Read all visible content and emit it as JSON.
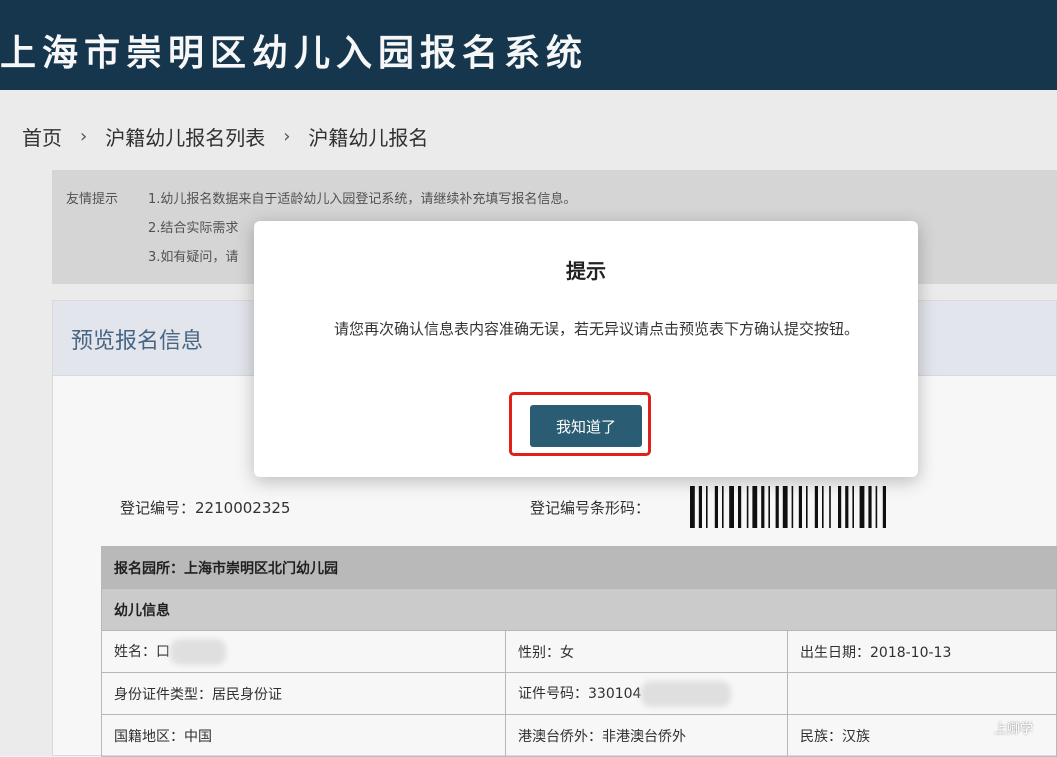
{
  "app": {
    "title": "上海市崇明区幼儿入园报名系统"
  },
  "breadcrumb": {
    "items": [
      "首页",
      "沪籍幼儿报名列表",
      "沪籍幼儿报名"
    ],
    "separator": "›"
  },
  "notice": {
    "label": "友情提示",
    "lines": [
      "1.幼儿报名数据来自于适龄幼儿入园登记系统，请继续补充填写报名信息。",
      "2.结合实际需求",
      "3.如有疑问，请"
    ]
  },
  "panel": {
    "title": "预览报名信息"
  },
  "registration": {
    "number_label": "登记编号：",
    "number_value": "2210002325",
    "barcode_label": "登记编号条形码："
  },
  "table": {
    "school_label": "报名园所：",
    "school_value": "上海市崇明区北门幼儿园",
    "section_title": "幼儿信息",
    "rows": [
      [
        "姓名：口",
        "性别：女",
        "出生日期：2018-10-13"
      ],
      [
        "身份证件类型：居民身份证",
        "证件号码：330104",
        ""
      ],
      [
        "国籍地区：中国",
        "港澳台侨外：非港澳台侨外",
        "民族：汉族"
      ]
    ]
  },
  "modal": {
    "title": "提示",
    "message": "请您再次确认信息表内容准确无误，若无异议请点击预览表下方确认提交按钮。",
    "ok_label": "我知道了"
  },
  "watermark": "上卿学",
  "colors": {
    "header": "#16384f",
    "button": "#2a5d73",
    "highlight": "#e0201a"
  }
}
